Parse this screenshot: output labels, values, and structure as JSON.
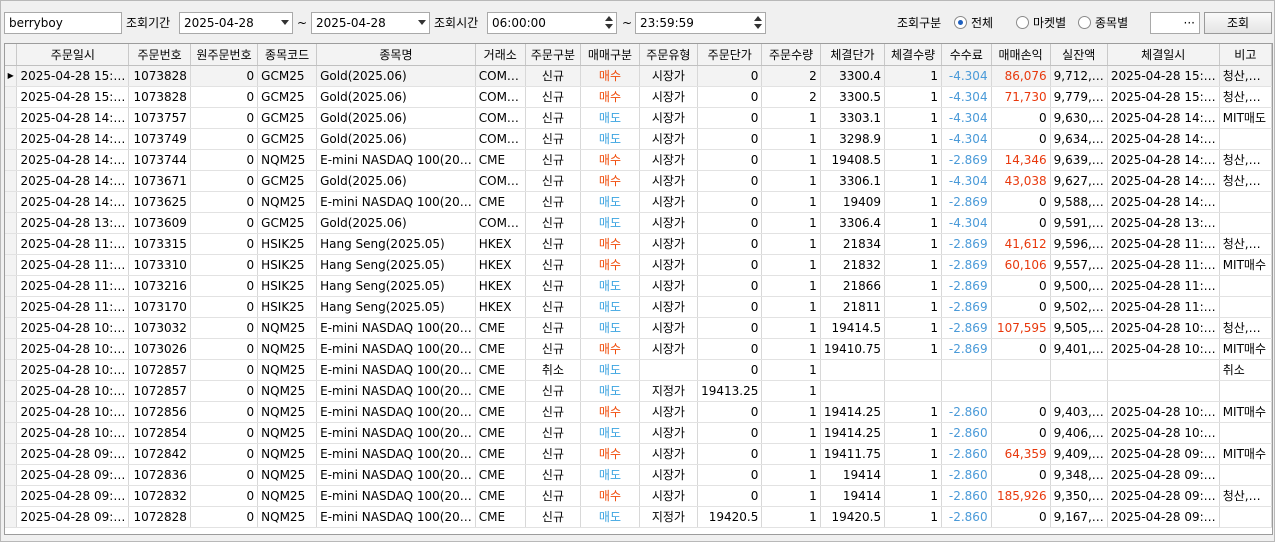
{
  "toolbar": {
    "account": "berryboy",
    "period_label": "조회기간",
    "date_from": "2025-04-28",
    "tilde1": "~",
    "date_to": "2025-04-28",
    "time_label": "조회시간",
    "time_from": "06:00:00",
    "tilde2": "~",
    "time_to": "23:59:59",
    "filter_label": "조회구분",
    "radio_all": "전체",
    "radio_market": "마켓별",
    "radio_item": "종목별",
    "item_more": "···",
    "search_button": "조회",
    "selected_radio": "전체"
  },
  "colors": {
    "buy": "#f04a08",
    "sell": "#3aa3e0",
    "fee": "#4a9ad8",
    "profit": "#e8380c"
  },
  "grid": {
    "columns": [
      "주문일시",
      "주문번호",
      "원주문번호",
      "종목코드",
      "종목명",
      "거래소",
      "주문구분",
      "매매구분",
      "주문유형",
      "주문단가",
      "주문수량",
      "체결단가",
      "체결수량",
      "수수료",
      "매매손익",
      "실잔액",
      "체결일시",
      "비고"
    ],
    "rows": [
      [
        "2025-04-28 15:…",
        "1073828",
        "0",
        "GCM25",
        "Gold(2025.06)",
        "COM…",
        "신규",
        "매수",
        "시장가",
        "0",
        "2",
        "3300.4",
        "1",
        "-4.304",
        "86,076",
        "9,712,…",
        "2025-04-28 15:…",
        "청산,…"
      ],
      [
        "2025-04-28 15:…",
        "1073828",
        "0",
        "GCM25",
        "Gold(2025.06)",
        "COM…",
        "신규",
        "매수",
        "시장가",
        "0",
        "2",
        "3300.5",
        "1",
        "-4.304",
        "71,730",
        "9,779,…",
        "2025-04-28 15:…",
        "청산,…"
      ],
      [
        "2025-04-28 14:…",
        "1073757",
        "0",
        "GCM25",
        "Gold(2025.06)",
        "COM…",
        "신규",
        "매도",
        "시장가",
        "0",
        "1",
        "3303.1",
        "1",
        "-4.304",
        "0",
        "9,630,…",
        "2025-04-28 14:…",
        "MIT매도"
      ],
      [
        "2025-04-28 14:…",
        "1073749",
        "0",
        "GCM25",
        "Gold(2025.06)",
        "COM…",
        "신규",
        "매도",
        "시장가",
        "0",
        "1",
        "3298.9",
        "1",
        "-4.304",
        "0",
        "9,634,…",
        "2025-04-28 14:…",
        ""
      ],
      [
        "2025-04-28 14:…",
        "1073744",
        "0",
        "NQM25",
        "E-mini NASDAQ 100(20…",
        "CME",
        "신규",
        "매수",
        "시장가",
        "0",
        "1",
        "19408.5",
        "1",
        "-2.869",
        "14,346",
        "9,639,…",
        "2025-04-28 14:…",
        "청산,…"
      ],
      [
        "2025-04-28 14:…",
        "1073671",
        "0",
        "GCM25",
        "Gold(2025.06)",
        "COM…",
        "신규",
        "매수",
        "시장가",
        "0",
        "1",
        "3306.1",
        "1",
        "-4.304",
        "43,038",
        "9,627,…",
        "2025-04-28 14:…",
        "청산,…"
      ],
      [
        "2025-04-28 14:…",
        "1073625",
        "0",
        "NQM25",
        "E-mini NASDAQ 100(20…",
        "CME",
        "신규",
        "매도",
        "시장가",
        "0",
        "1",
        "19409",
        "1",
        "-2.869",
        "0",
        "9,588,…",
        "2025-04-28 14:…",
        ""
      ],
      [
        "2025-04-28 13:…",
        "1073609",
        "0",
        "GCM25",
        "Gold(2025.06)",
        "COM…",
        "신규",
        "매도",
        "시장가",
        "0",
        "1",
        "3306.4",
        "1",
        "-4.304",
        "0",
        "9,591,…",
        "2025-04-28 13:…",
        ""
      ],
      [
        "2025-04-28 11:…",
        "1073315",
        "0",
        "HSIK25",
        "Hang Seng(2025.05)",
        "HKEX",
        "신규",
        "매수",
        "시장가",
        "0",
        "1",
        "21834",
        "1",
        "-2.869",
        "41,612",
        "9,596,…",
        "2025-04-28 11:…",
        "청산,…"
      ],
      [
        "2025-04-28 11:…",
        "1073310",
        "0",
        "HSIK25",
        "Hang Seng(2025.05)",
        "HKEX",
        "신규",
        "매수",
        "시장가",
        "0",
        "1",
        "21832",
        "1",
        "-2.869",
        "60,106",
        "9,557,…",
        "2025-04-28 11:…",
        "MIT매수"
      ],
      [
        "2025-04-28 11:…",
        "1073216",
        "0",
        "HSIK25",
        "Hang Seng(2025.05)",
        "HKEX",
        "신규",
        "매도",
        "시장가",
        "0",
        "1",
        "21866",
        "1",
        "-2.869",
        "0",
        "9,500,…",
        "2025-04-28 11:…",
        ""
      ],
      [
        "2025-04-28 11:…",
        "1073170",
        "0",
        "HSIK25",
        "Hang Seng(2025.05)",
        "HKEX",
        "신규",
        "매도",
        "시장가",
        "0",
        "1",
        "21811",
        "1",
        "-2.869",
        "0",
        "9,502,…",
        "2025-04-28 11:…",
        ""
      ],
      [
        "2025-04-28 10:…",
        "1073032",
        "0",
        "NQM25",
        "E-mini NASDAQ 100(20…",
        "CME",
        "신규",
        "매도",
        "시장가",
        "0",
        "1",
        "19414.5",
        "1",
        "-2.869",
        "107,595",
        "9,505,…",
        "2025-04-28 10:…",
        "청산,…"
      ],
      [
        "2025-04-28 10:…",
        "1073026",
        "0",
        "NQM25",
        "E-mini NASDAQ 100(20…",
        "CME",
        "신규",
        "매수",
        "시장가",
        "0",
        "1",
        "19410.75",
        "1",
        "-2.869",
        "0",
        "9,401,…",
        "2025-04-28 10:…",
        "MIT매수"
      ],
      [
        "2025-04-28 10:…",
        "1072857",
        "0",
        "NQM25",
        "E-mini NASDAQ 100(20…",
        "CME",
        "취소",
        "매도",
        "",
        "0",
        "1",
        "",
        "",
        "",
        "",
        "",
        "",
        "취소"
      ],
      [
        "2025-04-28 10:…",
        "1072857",
        "0",
        "NQM25",
        "E-mini NASDAQ 100(20…",
        "CME",
        "신규",
        "매도",
        "지정가",
        "19413.25",
        "1",
        "",
        "",
        "",
        "",
        "",
        "",
        ""
      ],
      [
        "2025-04-28 10:…",
        "1072856",
        "0",
        "NQM25",
        "E-mini NASDAQ 100(20…",
        "CME",
        "신규",
        "매수",
        "시장가",
        "0",
        "1",
        "19414.25",
        "1",
        "-2.860",
        "0",
        "9,403,…",
        "2025-04-28 10:…",
        "MIT매수"
      ],
      [
        "2025-04-28 10:…",
        "1072854",
        "0",
        "NQM25",
        "E-mini NASDAQ 100(20…",
        "CME",
        "신규",
        "매도",
        "시장가",
        "0",
        "1",
        "19414.25",
        "1",
        "-2.860",
        "0",
        "9,406,…",
        "2025-04-28 10:…",
        ""
      ],
      [
        "2025-04-28 09:…",
        "1072842",
        "0",
        "NQM25",
        "E-mini NASDAQ 100(20…",
        "CME",
        "신규",
        "매수",
        "시장가",
        "0",
        "1",
        "19411.75",
        "1",
        "-2.860",
        "64,359",
        "9,409,…",
        "2025-04-28 09:…",
        "MIT매수"
      ],
      [
        "2025-04-28 09:…",
        "1072836",
        "0",
        "NQM25",
        "E-mini NASDAQ 100(20…",
        "CME",
        "신규",
        "매도",
        "시장가",
        "0",
        "1",
        "19414",
        "1",
        "-2.860",
        "0",
        "9,348,…",
        "2025-04-28 09:…",
        ""
      ],
      [
        "2025-04-28 09:…",
        "1072832",
        "0",
        "NQM25",
        "E-mini NASDAQ 100(20…",
        "CME",
        "신규",
        "매수",
        "시장가",
        "0",
        "1",
        "19414",
        "1",
        "-2.860",
        "185,926",
        "9,350,…",
        "2025-04-28 09:…",
        "청산,…"
      ],
      [
        "2025-04-28 09:…",
        "1072828",
        "0",
        "NQM25",
        "E-mini NASDAQ 100(20…",
        "CME",
        "신규",
        "매도",
        "지정가",
        "19420.5",
        "1",
        "19420.5",
        "1",
        "-2.860",
        "0",
        "9,167,…",
        "2025-04-28 09:…",
        ""
      ]
    ]
  }
}
